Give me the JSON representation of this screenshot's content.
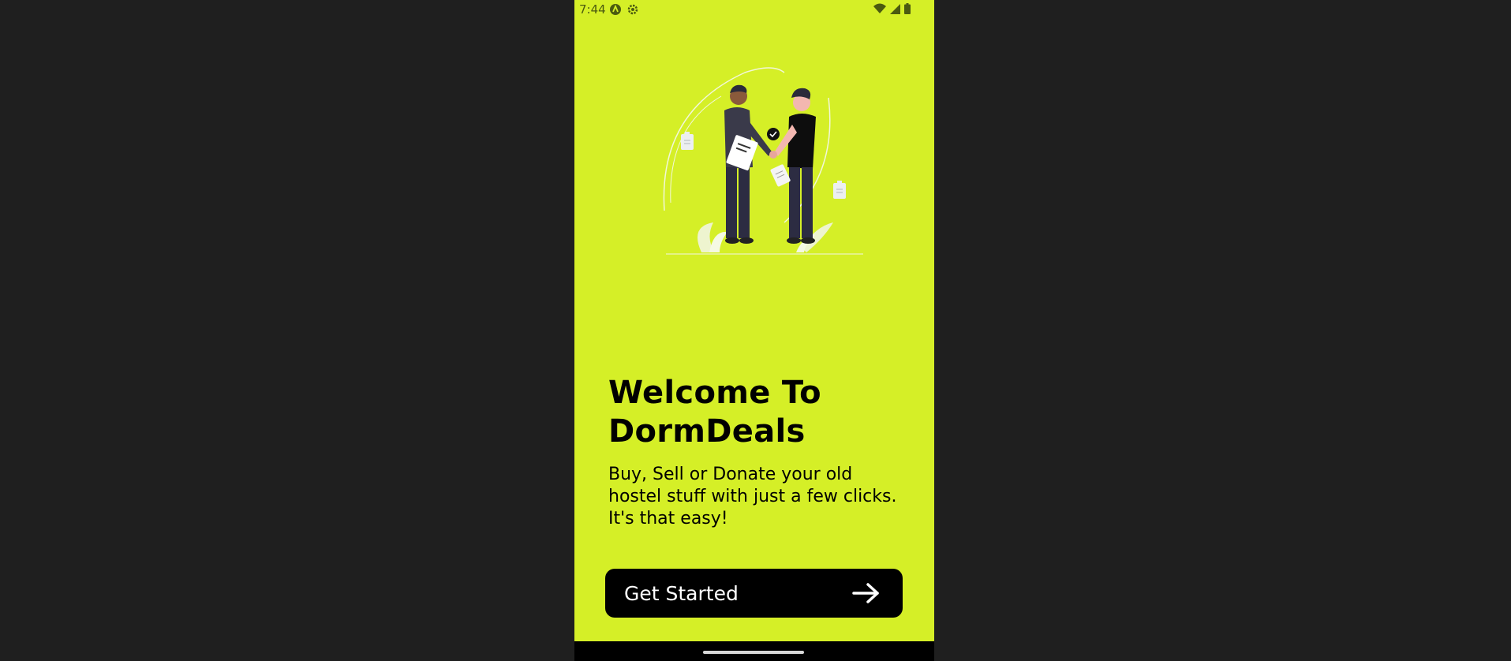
{
  "status_bar": {
    "time": "7:44",
    "icons": [
      "android-auto-icon",
      "settings-gear-icon",
      "wifi-icon",
      "signal-icon",
      "battery-icon"
    ]
  },
  "illustration": {
    "icon": "handshake-illustration"
  },
  "welcome": {
    "title_line1": "Welcome To",
    "title_line2": "DormDeals",
    "subtitle": "Buy, Sell or Donate your old hostel stuff with just a few clicks. It's that easy!"
  },
  "cta": {
    "label": "Get Started",
    "icon": "arrow-right-icon"
  },
  "colors": {
    "background": "#d5ef27",
    "button": "#000000",
    "button_text": "#ffffff",
    "outer": "#1f1f1f"
  }
}
